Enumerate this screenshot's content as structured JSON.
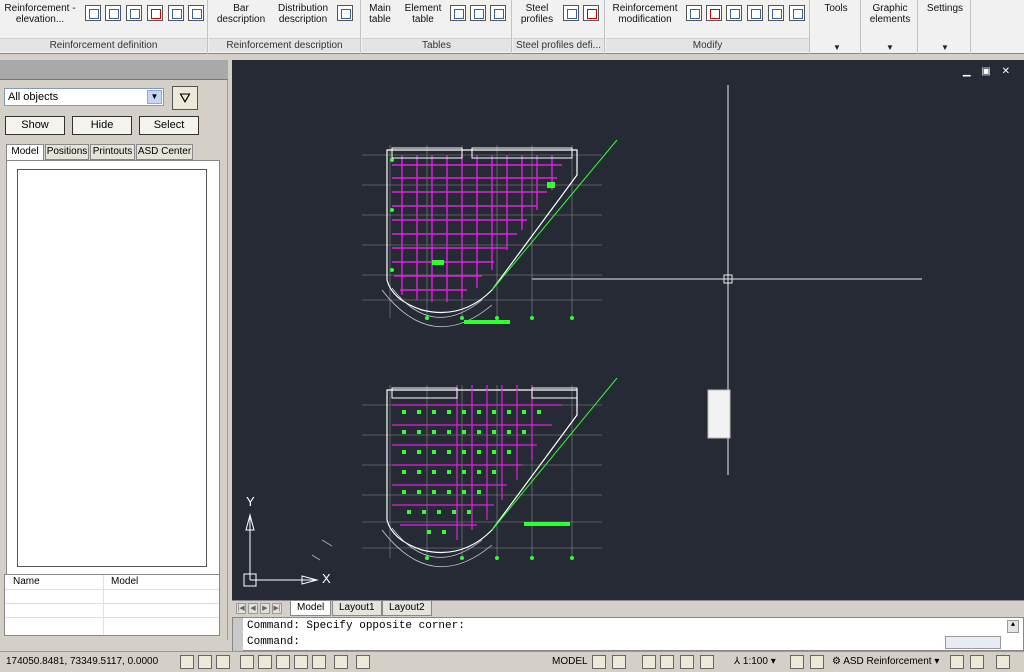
{
  "ribbon": {
    "panels": [
      {
        "title": "Reinforcement definition",
        "buttons": [
          "Reinforcement - elevation..."
        ]
      },
      {
        "title": "Reinforcement description",
        "buttons": [
          "Bar description",
          "Distribution description"
        ]
      },
      {
        "title": "Tables",
        "buttons": [
          "Main table",
          "Element table"
        ]
      },
      {
        "title": "Steel profiles defi...",
        "buttons": [
          "Steel profiles"
        ]
      },
      {
        "title": "Modify",
        "buttons": [
          "Reinforcement modification"
        ]
      },
      {
        "title": "",
        "buttons": [
          "Tools"
        ]
      },
      {
        "title": "",
        "buttons": [
          "Graphic elements"
        ]
      },
      {
        "title": "",
        "buttons": [
          "Settings"
        ]
      }
    ],
    "rf_line1": "Reinforcement -",
    "rf_line2": "elevation...",
    "bar_line1": "Bar",
    "bar_line2": "description",
    "dist_line1": "Distribution",
    "dist_line2": "description",
    "main_line1": "Main",
    "main_line2": "table",
    "elem_line1": "Element",
    "elem_line2": "table",
    "steel_line1": "Steel",
    "steel_line2": "profiles",
    "mod_line1": "Reinforcement",
    "mod_line2": "modification",
    "tools": "Tools",
    "graphic_line1": "Graphic",
    "graphic_line2": "elements",
    "settings": "Settings",
    "title_rd": "Reinforcement definition",
    "title_rdesc": "Reinforcement description",
    "title_tables": "Tables",
    "title_steel": "Steel profiles defi...",
    "title_modify": "Modify"
  },
  "palette": {
    "filter_value": "All objects",
    "show": "Show",
    "hide": "Hide",
    "select": "Select",
    "tabs": [
      "Model",
      "Positions",
      "Printouts",
      "ASD Center"
    ],
    "grid_col1": "Name",
    "grid_col2": "Model"
  },
  "layout_tabs": [
    "Model",
    "Layout1",
    "Layout2"
  ],
  "command": {
    "line1": "Command: Specify opposite corner:",
    "line2": "Command:"
  },
  "status": {
    "coords": "174050.8481, 73349.5117, 0.0000",
    "model": "MODEL",
    "scale": "1:100",
    "workspace": "ASD Reinforcement"
  },
  "ucs": {
    "x": "X",
    "y": "Y"
  },
  "colors": {
    "canvas": "#262a35",
    "rebar": "#e020e0",
    "annotation": "#30ff30",
    "lines": "#ffffff"
  }
}
